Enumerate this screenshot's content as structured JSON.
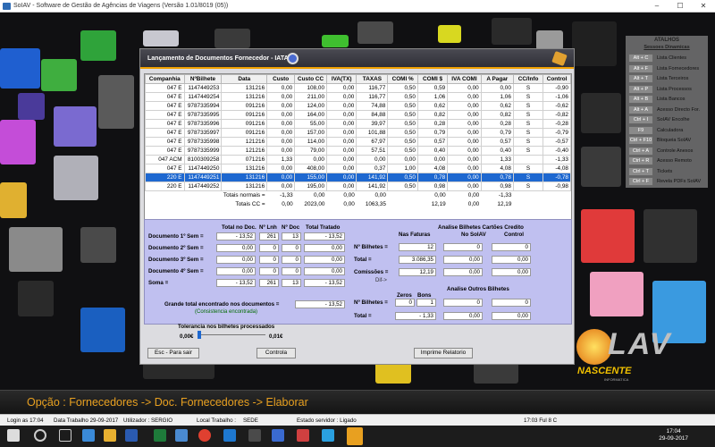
{
  "window": {
    "title": "SoIAV - Software de Gestão de Agências de Viagens (Versão 1.01/8019 (05))",
    "min": "–",
    "max": "☐",
    "close": "✕"
  },
  "dialog": {
    "title": "Lançamento de Documentos Fornecedor - IATA"
  },
  "table": {
    "headers": [
      "Companhia",
      "NºBilhete",
      "Data",
      "Custo",
      "Custo CC",
      "IVA(TX)",
      "TAXAS",
      "COMI %",
      "COMI $",
      "IVA COMI",
      "A Pagar",
      "CC/Info",
      "Control"
    ],
    "rows": [
      [
        "047 E",
        "1147449253",
        "131216",
        "0,00",
        "108,00",
        "0,00",
        "116,77",
        "0,50",
        "0,59",
        "0,00",
        "0,00",
        "S",
        "-0,90"
      ],
      [
        "047 E",
        "1147449254",
        "131216",
        "0,00",
        "211,00",
        "0,00",
        "116,77",
        "0,50",
        "1,06",
        "0,00",
        "1,06",
        "S",
        "-1,06"
      ],
      [
        "047 E",
        "9787335994",
        "091216",
        "0,00",
        "124,00",
        "0,00",
        "74,88",
        "0,50",
        "0,62",
        "0,00",
        "0,62",
        "S",
        "-0,62"
      ],
      [
        "047 E",
        "9787335995",
        "091216",
        "0,00",
        "164,00",
        "0,00",
        "84,88",
        "0,50",
        "0,82",
        "0,00",
        "0,82",
        "S",
        "-0,82"
      ],
      [
        "047 E",
        "9787335996",
        "091216",
        "0,00",
        "55,00",
        "0,00",
        "39,97",
        "0,50",
        "0,28",
        "0,00",
        "0,28",
        "S",
        "-0,28"
      ],
      [
        "047 E",
        "9787335997",
        "091216",
        "0,00",
        "157,00",
        "0,00",
        "101,88",
        "0,50",
        "0,79",
        "0,00",
        "0,79",
        "S",
        "-0,79"
      ],
      [
        "047 E",
        "9787335998",
        "121216",
        "0,00",
        "114,00",
        "0,00",
        "67,97",
        "0,50",
        "0,57",
        "0,00",
        "0,57",
        "S",
        "-0,57"
      ],
      [
        "047 E",
        "9787335999",
        "121216",
        "0,00",
        "79,00",
        "0,00",
        "57,51",
        "0,50",
        "0,40",
        "0,00",
        "0,40",
        "S",
        "-0,40"
      ],
      [
        "047 ACM",
        "8100309258",
        "071216",
        "1,33",
        "0,00",
        "0,00",
        "0,00",
        "0,00",
        "0,00",
        "0,00",
        "1,33",
        "",
        "-1,33"
      ],
      [
        "047 E",
        "1147449250",
        "131216",
        "0,00",
        "408,00",
        "0,00",
        "0,37",
        "1,00",
        "4,08",
        "0,00",
        "4,08",
        "S",
        "-4,08"
      ],
      [
        "220 E",
        "1147449251",
        "131216",
        "0,00",
        "155,00",
        "0,00",
        "141,92",
        "0,50",
        "0,78",
        "0,00",
        "0,78",
        "S",
        "-0,78"
      ],
      [
        "220 E",
        "1147449252",
        "131216",
        "0,00",
        "195,00",
        "0,00",
        "141,92",
        "0,50",
        "0,98",
        "0,00",
        "0,98",
        "S",
        "-0,98"
      ]
    ],
    "selected_row": 10,
    "totals_normais": {
      "label": "Totais normais =",
      "custo": "-1,33",
      "custo_cc": "0,00",
      "iva": "0,00",
      "taxas": "0,00",
      "comi": "0,00",
      "iva_comi": "0,00",
      "a_pagar": "-1,33"
    },
    "totals_cc": {
      "label": "Totais CC =",
      "custo": "0,00",
      "custo_cc": "2023,00",
      "iva": "0,00",
      "taxas": "1063,35",
      "comi": "12,19",
      "iva_comi": "0,00",
      "a_pagar": "12,19"
    }
  },
  "docs": {
    "headers": {
      "total": "Total no Doc.",
      "lnh": "Nº Lnh",
      "doc": "Nº Doc",
      "tratado": "Total Tratado"
    },
    "rows": [
      {
        "label": "Documento 1º Sem =",
        "total": "- 13,52",
        "lnh": "261",
        "doc": "13",
        "tratado": "- 13,52"
      },
      {
        "label": "Documento 2º Sem =",
        "total": "0,00",
        "lnh": "0",
        "doc": "0",
        "tratado": "0,00"
      },
      {
        "label": "Documento 3º Sem =",
        "total": "0,00",
        "lnh": "0",
        "doc": "0",
        "tratado": "0,00"
      },
      {
        "label": "Documento 4º Sem =",
        "total": "0,00",
        "lnh": "0",
        "doc": "0",
        "tratado": "0,00"
      },
      {
        "label": "Soma =",
        "total": "- 13,52",
        "lnh": "261",
        "doc": "13",
        "tratado": "- 13,52"
      }
    ],
    "grand_label": "Grande total encontrado nos documentos =",
    "grand_value": "- 13,52",
    "grand_note": "(Consistencia encontrada)"
  },
  "cartoes": {
    "title": "Analise Bilhetes Cartões Credito",
    "headers": {
      "faturas": "Nas Faturas",
      "solav": "No SoIAV",
      "control": "Control"
    },
    "bilhetes": {
      "label": "Nº Bilhetes =",
      "faturas": "12",
      "solav": "0",
      "control": "0"
    },
    "total": {
      "label": "Total =",
      "faturas": "3.086,35",
      "solav": "0,00",
      "control": "0,00"
    },
    "comissoes": {
      "label": "Comissões =",
      "faturas": "12,19",
      "solav": "0,00",
      "control": "0,00"
    },
    "dif": "Dif->"
  },
  "outros": {
    "title": "Analise Outros Bilhetes",
    "headers": {
      "zeros": "Zeros",
      "bons": "Bons"
    },
    "bilhetes": {
      "label": "Nº Bilhetes =",
      "zeros": "0",
      "bons": "1",
      "solav": "0",
      "control": "0"
    },
    "total": {
      "label": "Total =",
      "faturas": "- 1,33",
      "solav": "0,00",
      "control": "0,00"
    }
  },
  "tolerancia": {
    "label": "Tolerancia nos bilhetes processados",
    "min": "0,00€",
    "max": "0,01€"
  },
  "buttons": {
    "sair": "Esc - Para sair",
    "controla": "Controla",
    "imprime": "Imprime Relatorio"
  },
  "shortcuts": {
    "title": "ATALHOS",
    "subtitle": "Sessoes Dinamicas",
    "items": [
      {
        "key": "Alt + C",
        "label": "Lista Clientes"
      },
      {
        "key": "Alt + F",
        "label": "Lista Fornecedores"
      },
      {
        "key": "Alt + T",
        "label": "Lista Terceiros"
      },
      {
        "key": "Alt + P",
        "label": "Lista Processos"
      },
      {
        "key": "Alt + B",
        "label": "Lista Bancos"
      },
      {
        "key": "Alt + A",
        "label": "Acesso Directo For."
      },
      {
        "key": "Ctrl + I",
        "label": "SoIAV Encolhe"
      },
      {
        "key": "F9",
        "label": "Calculadora"
      },
      {
        "key": "Ctrl + F10",
        "label": "Bloqueia SoIAV"
      },
      {
        "key": "Ctrl + A",
        "label": "Controle Anexos"
      },
      {
        "key": "Ctrl + R",
        "label": "Acesso Remoto"
      },
      {
        "key": "Ctrl + T",
        "label": "Tickets"
      },
      {
        "key": "Ctrl + F",
        "label": "Revela PDFs SoIAV"
      }
    ]
  },
  "brand": {
    "text": "LAV",
    "nascente": "NASCENTE",
    "sub": "INFORMATICA"
  },
  "option_bar": "Opção : Fornecedores -> Doc. Fornecedores -> Elaborar",
  "status": {
    "login": "Login as 17:04",
    "data": "Data Trabalho 29-09-2017",
    "user": "Utilizador : SERGIO",
    "local": "Local Trabalho :",
    "sede": "SEDE",
    "servidor": "Estado servidor : Ligado",
    "hora": "17:03 Ful 8 C"
  },
  "clock": {
    "time": "17:04",
    "date": "29-09-2017"
  }
}
